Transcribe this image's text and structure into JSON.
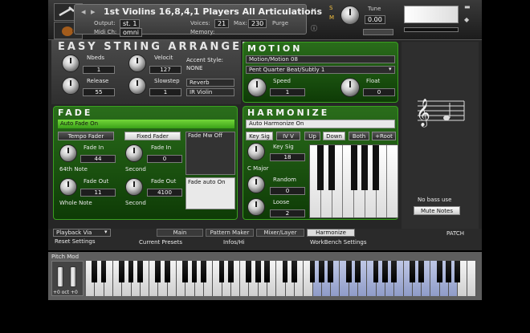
{
  "header": {
    "instrument_name": "1st Violins 16,8,4,1 Players All Articulations",
    "output_label": "Output:",
    "output_value": "st. 1",
    "voices_label": "Voices:",
    "voices_value": "21",
    "max_label": "Max:",
    "max_value": "230",
    "purge_label": "Purge",
    "midi_label": "Midi Ch:",
    "midi_value": "omni",
    "memory_label": "Memory:",
    "tune_label": "Tune",
    "tune_value": "0.00",
    "s_label": "S",
    "m_label": "M"
  },
  "main": {
    "title": "EASY STRING ARRANGER",
    "controls": {
      "nbeds_label": "Nbeds",
      "nbeds_value": "1",
      "velocity_label": "Velocit",
      "velocity_value": "127",
      "release_label": "Release",
      "release_value": "55",
      "slowstep_label": "Slowstep",
      "slowstep_value": "1",
      "accent_style_label": "Accent Style:",
      "accent_style_value": "NONE",
      "reverb_label": "Reverb",
      "reverb_value": "IR Violin"
    }
  },
  "motion": {
    "title": "MOTION",
    "dropdown1": "Motion/Motion 08",
    "dropdown2": "Pent Quarter Beat/Subtly 1",
    "speed_label": "Speed",
    "speed_value": "1",
    "float_label": "Float",
    "float_value": "0"
  },
  "fade": {
    "title": "FADE",
    "auto_fade": "Auto Fade On",
    "tempo_fader": "Tempo Fader",
    "fixed_fader": "Fixed Fader",
    "fade_mw": "Fade Mw Off",
    "fade_in_label": "Fade In",
    "fade_in_value": "44",
    "fade_in_note": "64th Note",
    "fade_in2_label": "Fade In",
    "fade_in2_value": "0",
    "fade_in2_unit": "Second",
    "fade_out_label": "Fade Out",
    "fade_out_value": "11",
    "fade_out_note": "Whole Note",
    "fade_out2_label": "Fade Out",
    "fade_out2_value": "4100",
    "fade_out2_unit": "Second",
    "fade_auto_on": "Fade auto On"
  },
  "harmonize": {
    "title": "HARMONIZE",
    "auto_harmonize": "Auto Harmonize On",
    "key_sig_btn": "Key Sig",
    "iv_v_btn": "IV V",
    "up_btn": "Up",
    "down_btn": "Down",
    "both_btn": "Both",
    "root_btn": "+Root",
    "key_sig_label": "Key Sig",
    "key_sig_value": "18",
    "key_name": "C Major",
    "random_label": "Random",
    "random_value": "0",
    "loose_label": "Loose",
    "loose_value": "2"
  },
  "side": {
    "no_bass_label": "No bass use",
    "mute_notes_btn": "Mute Notes"
  },
  "bottom": {
    "preset_dropdown": "Playback Via",
    "reset_settings": "Reset Settings",
    "tabs": [
      "Main",
      "Pattern Maker",
      "Mixer/Layer",
      "Harmonize"
    ],
    "sub_tabs": [
      "Current Presets",
      "Infos/Hi",
      "WorkBench Settings"
    ],
    "patch_label": "PATCH"
  },
  "keyboard": {
    "pitch_mod_label": "Pitch Mod",
    "octave_label": "+0  oct  +0"
  }
}
